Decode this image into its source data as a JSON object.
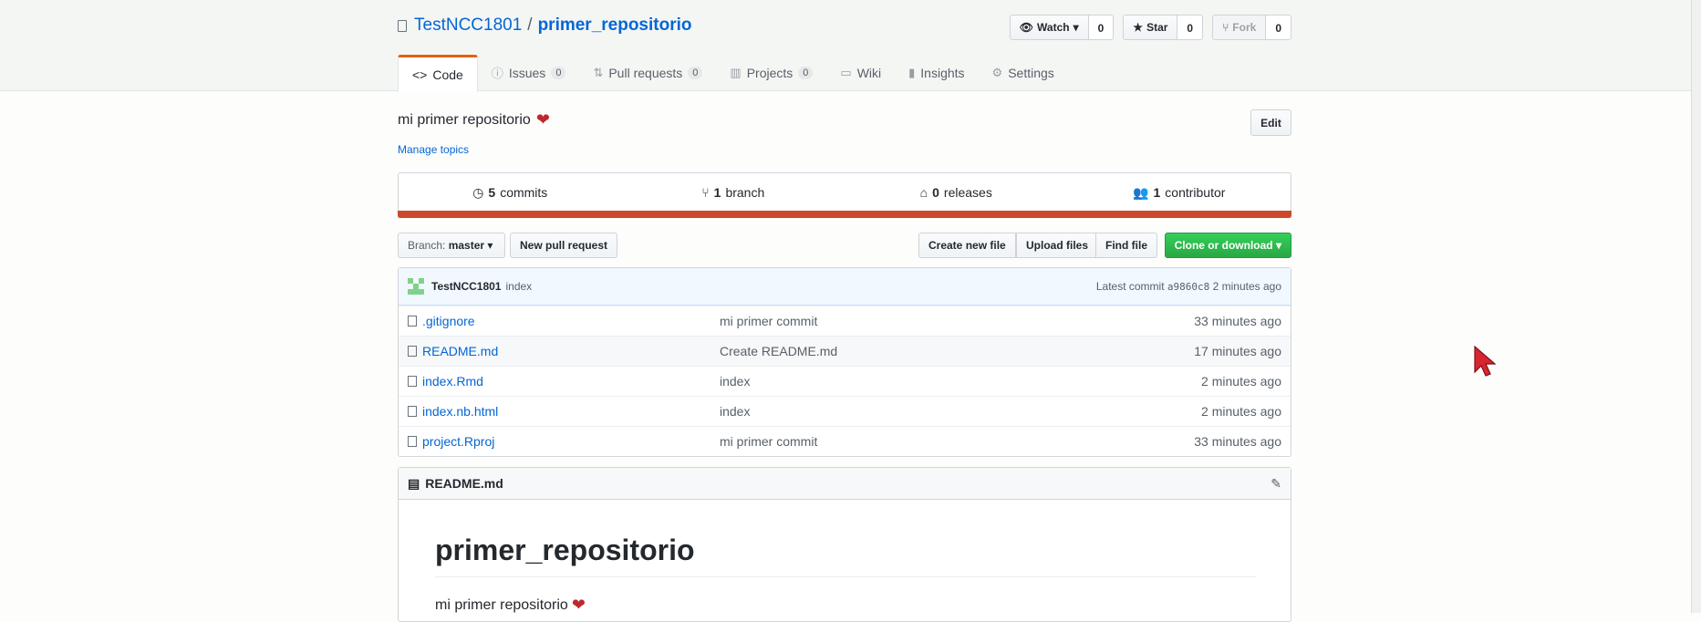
{
  "repo": {
    "owner": "TestNCC1801",
    "separator": "/",
    "name": "primer_repositorio"
  },
  "actions": [
    {
      "label": "Watch",
      "count": "0"
    },
    {
      "label": "Star",
      "count": "0"
    },
    {
      "label": "Fork",
      "count": "0"
    }
  ],
  "tabs": [
    {
      "label": "Code"
    },
    {
      "label": "Issues",
      "count": "0"
    },
    {
      "label": "Pull requests",
      "count": "0"
    },
    {
      "label": "Projects",
      "count": "0"
    },
    {
      "label": "Wiki"
    },
    {
      "label": "Insights"
    },
    {
      "label": "Settings"
    }
  ],
  "description": "mi primer repositorio",
  "edit_label": "Edit",
  "manage_topics": "Manage topics",
  "summary": {
    "commits": {
      "num": "5",
      "label": "commits"
    },
    "branch": {
      "num": "1",
      "label": "branch"
    },
    "releases": {
      "num": "0",
      "label": "releases"
    },
    "contributor": {
      "num": "1",
      "label": "contributor"
    }
  },
  "filenav": {
    "branch_prefix": "Branch:",
    "branch": "master",
    "new_pr": "New pull request",
    "create": "Create new file",
    "upload": "Upload files",
    "find": "Find file",
    "clone": "Clone or download"
  },
  "commit": {
    "author": "TestNCC1801",
    "message": "index",
    "latest": "Latest commit",
    "sha": "a9860c8",
    "age": "2 minutes ago"
  },
  "files": [
    {
      "name": ".gitignore",
      "message": "mi primer commit",
      "age": "33 minutes ago"
    },
    {
      "name": "README.md",
      "message": "Create README.md",
      "age": "17 minutes ago"
    },
    {
      "name": "index.Rmd",
      "message": "index",
      "age": "2 minutes ago"
    },
    {
      "name": "index.nb.html",
      "message": "index",
      "age": "2 minutes ago"
    },
    {
      "name": "project.Rproj",
      "message": "mi primer commit",
      "age": "33 minutes ago"
    }
  ],
  "readme": {
    "file": "README.md",
    "heading": "primer_repositorio",
    "body": "mi primer repositorio"
  },
  "colors": {
    "link": "#0366d6",
    "accent": "#e36209",
    "language": "#cc4a2b",
    "clone": "#28a745",
    "heart": "#c0272d"
  }
}
